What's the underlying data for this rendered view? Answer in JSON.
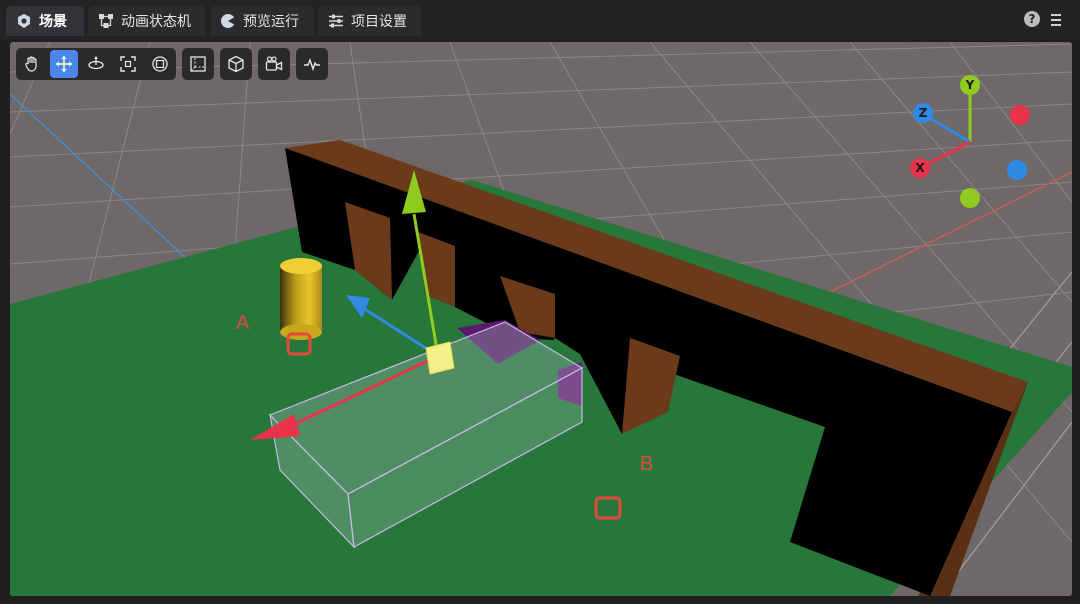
{
  "tabs": [
    {
      "label": "场景",
      "icon": "scene-icon",
      "active": true
    },
    {
      "label": "动画状态机",
      "icon": "animation-graph-icon",
      "active": false
    },
    {
      "label": "预览运行",
      "icon": "preview-run-icon",
      "active": false
    },
    {
      "label": "项目设置",
      "icon": "project-settings-icon",
      "active": false
    }
  ],
  "header": {
    "help_label": "?",
    "menu_icon": "menu-icon"
  },
  "toolbar": {
    "transform_tools": [
      "hand-tool-icon",
      "move-tool-icon",
      "rotate-tool-icon",
      "scale-tool-icon",
      "rect-tool-icon"
    ],
    "selected_tool": "move-tool-icon",
    "view_tools": [
      "ortho-view-icon",
      "3d-view-icon",
      "camera-view-icon",
      "stats-icon"
    ]
  },
  "scene": {
    "label_a": "A",
    "label_b": "B"
  },
  "gizmo": {
    "x_label": "X",
    "y_label": "Y",
    "z_label": "Z",
    "colors": {
      "x": "#e8334a",
      "y": "#8fcc1f",
      "z": "#2f8ae6"
    }
  },
  "colors": {
    "accent": "#4a86e8",
    "ground": "#27773a",
    "wall_top": "#6b3a1b",
    "wall_side": "#000000",
    "cylinder": "#d4b51c",
    "marker": "#e24a3c"
  }
}
